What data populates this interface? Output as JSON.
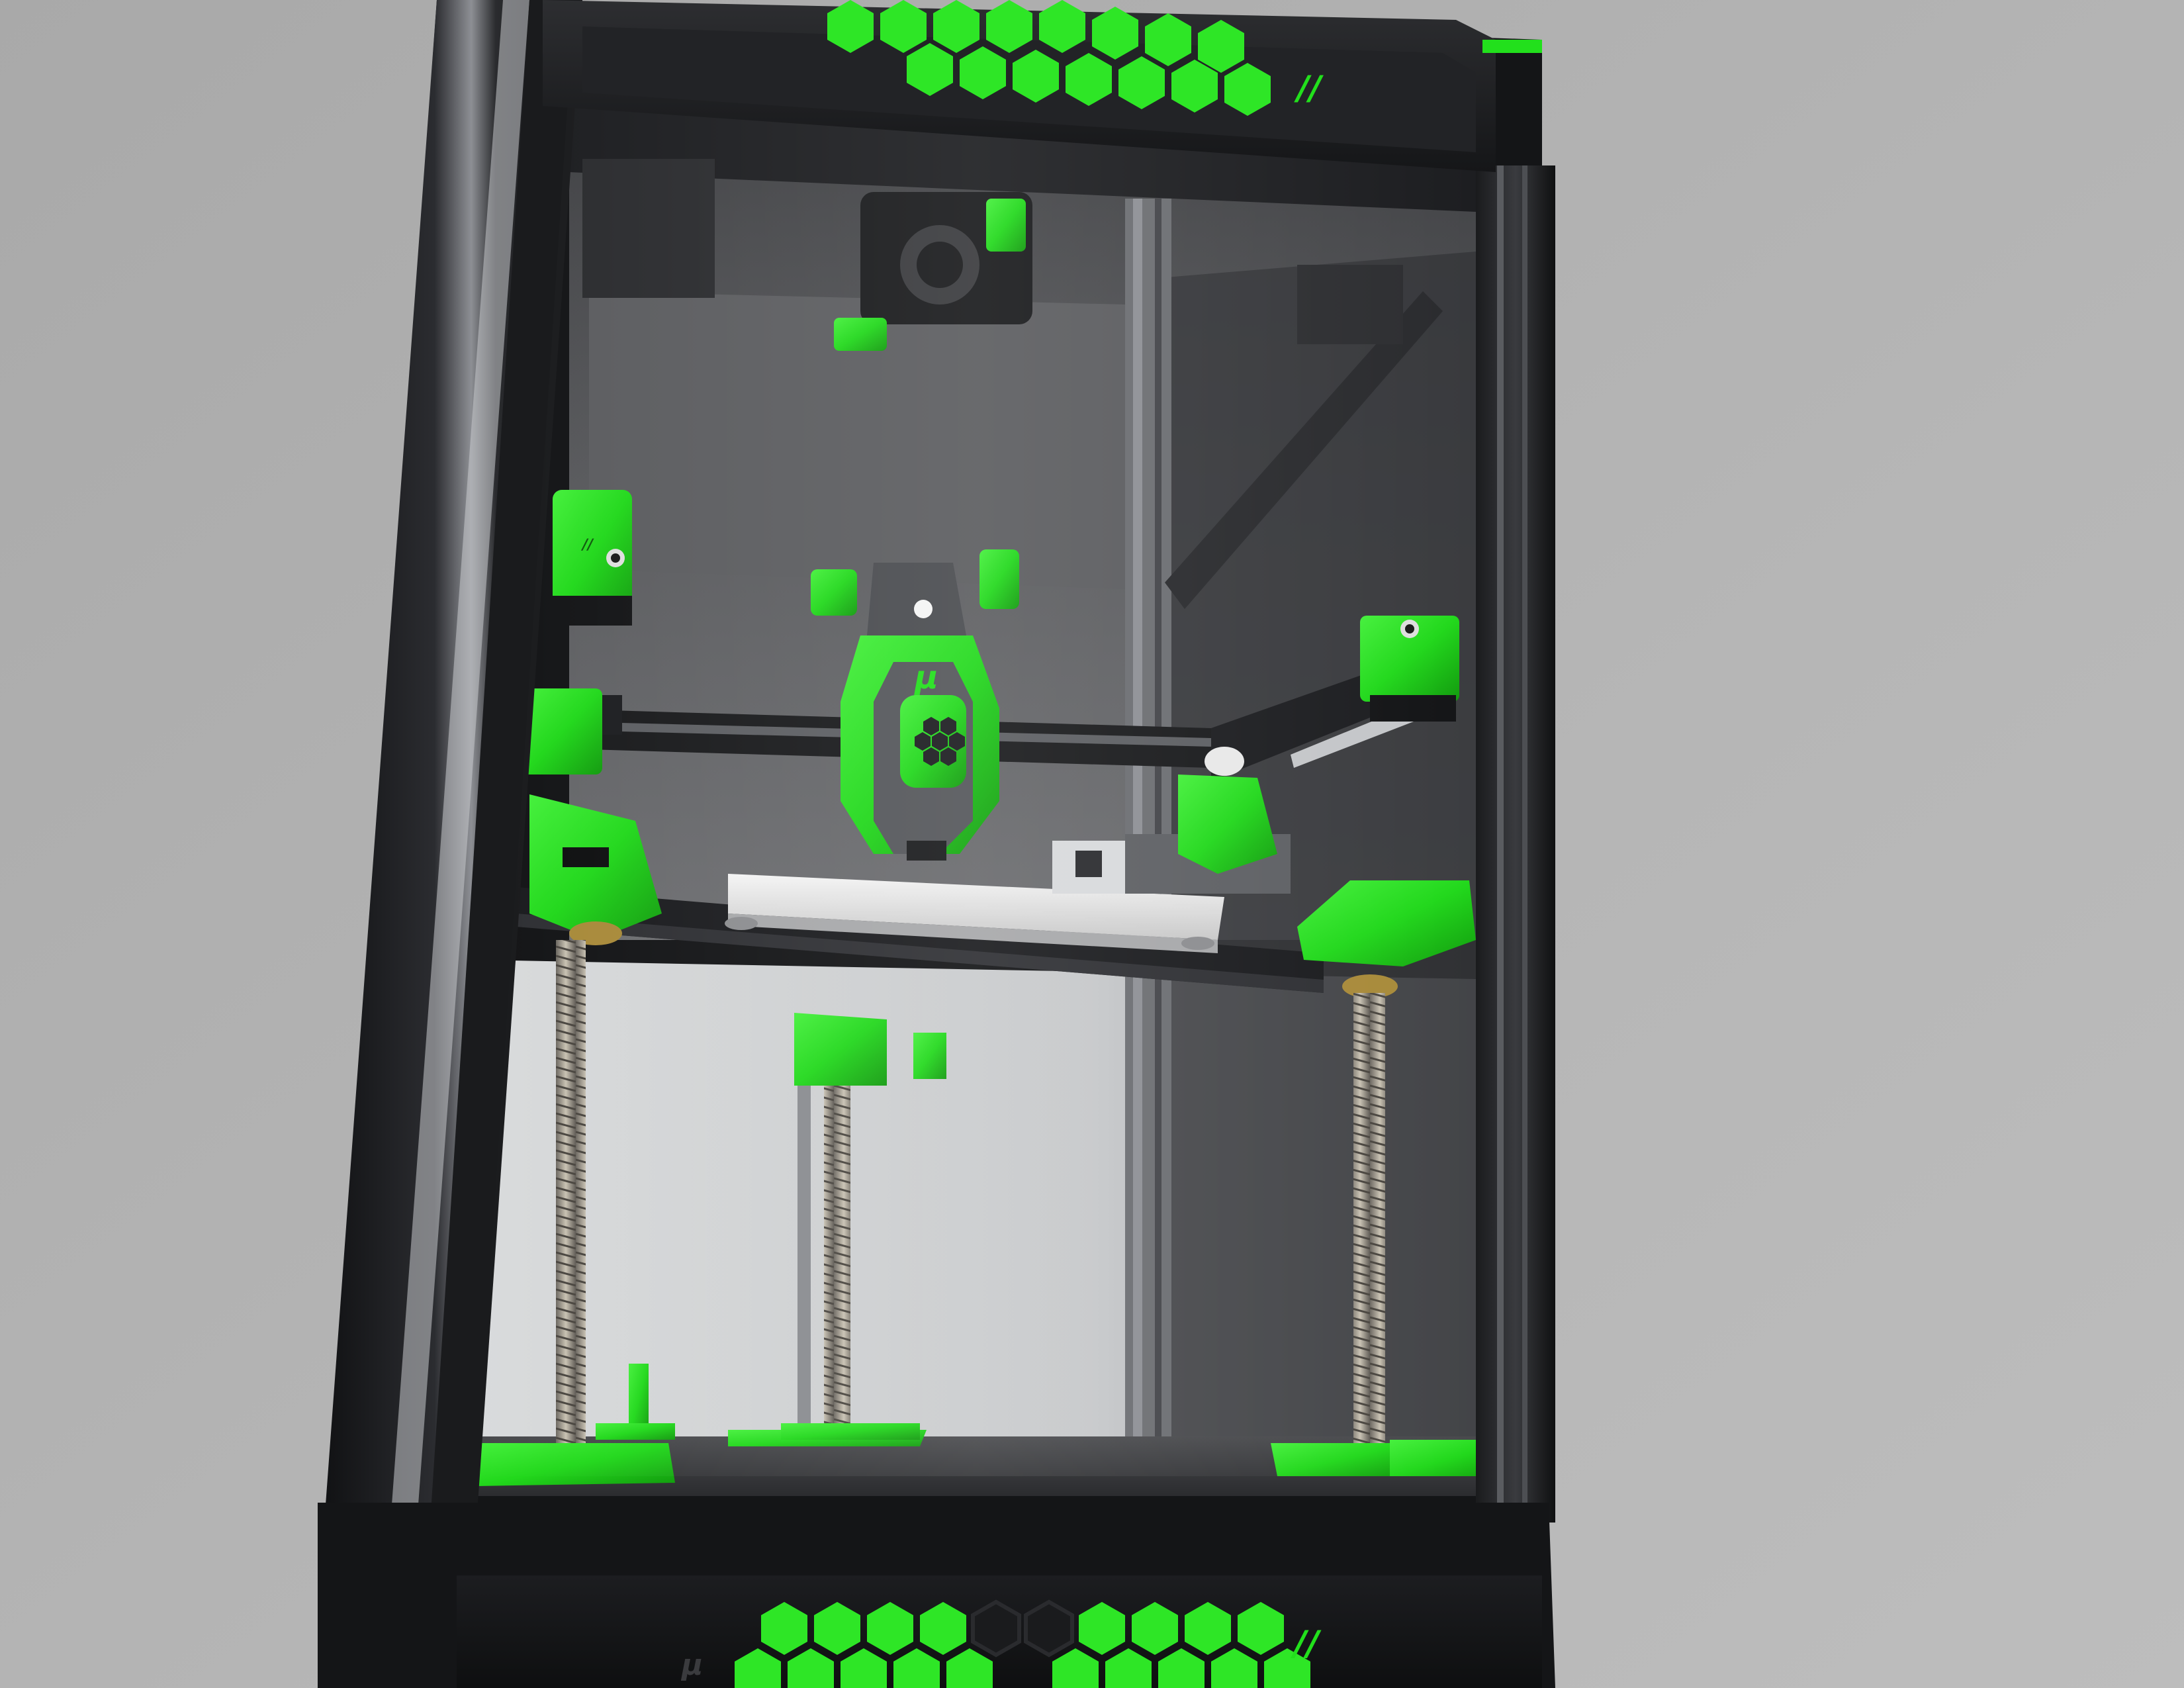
{
  "scene": {
    "description_free": true,
    "colors": {
      "background": "#b3b3b3",
      "frame_black": "#1b1c1e",
      "frame_dark": "#2a2b2e",
      "accent_green": "#22e01c",
      "accent_green_dark": "#139e10",
      "chamber_back": "#4e4f52",
      "chamber_floor": "#3a3b3d",
      "aluminum": "#9ea1a6",
      "bed_white": "#e8e8e8",
      "toolhead_grey": "#5a5c60"
    },
    "logos": {
      "toolhead_mark": "µ",
      "panel_mark": "//"
    },
    "icons": [
      "honeycomb-vent-icon",
      "printer-logo-icon"
    ]
  }
}
